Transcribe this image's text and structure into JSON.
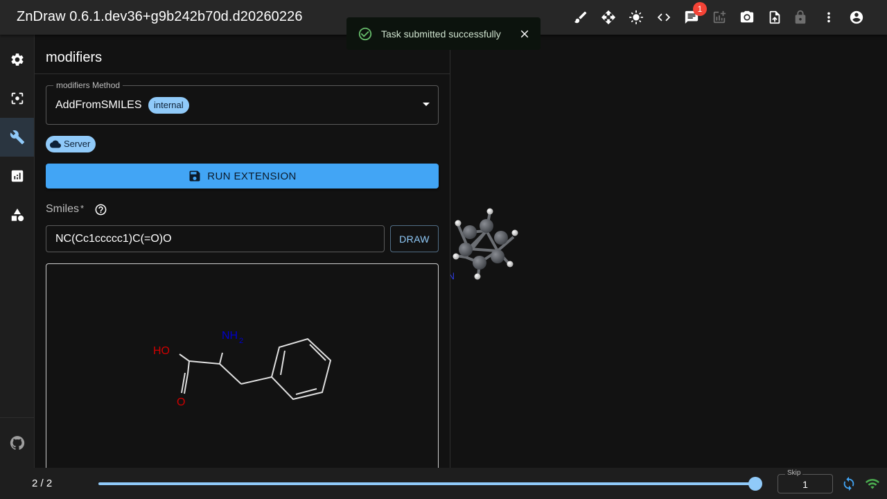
{
  "app": {
    "title": "ZnDraw 0.6.1.dev36+g9b242b70d.d20260226"
  },
  "toolbar": {
    "icons": [
      "brush-icon",
      "move-icon",
      "brightness-icon",
      "code-icon",
      "chat-icon",
      "add-chart-icon",
      "camera-icon",
      "upload-icon",
      "lock-icon",
      "more-vert-icon",
      "account-icon"
    ],
    "chat_badge": "1"
  },
  "toast": {
    "message": "Task submitted successfully",
    "color": "#66bb6a"
  },
  "sidebar": {
    "items": [
      "settings-icon",
      "selection-icon",
      "wrench-icon",
      "analysis-icon",
      "geometry-icon"
    ],
    "active": "wrench-icon",
    "footer": "github-icon"
  },
  "panel": {
    "title": "modifiers",
    "method_label": "modifiers Method",
    "method_value": "AddFromSMILES",
    "method_chip": "internal",
    "server_chip": "Server",
    "run_label": "RUN EXTENSION",
    "smiles_label": "Smiles",
    "smiles_required": "*",
    "smiles_value": "NC(Cc1ccccc1)C(=O)O",
    "draw_label": "DRAW"
  },
  "molecule": {
    "labels": {
      "hydroxyl": "HO",
      "amine": "NH",
      "amine_sub": "2",
      "carbonyl": "O"
    },
    "colors": {
      "oxygen": "#d00000",
      "nitrogen": "#0000cc",
      "bond": "#e0e0e0"
    }
  },
  "bottom": {
    "frame": "2 / 2",
    "progress": 1.0,
    "skip_label": "Skip",
    "skip_value": "1"
  },
  "colors": {
    "accent": "#90caf9",
    "primary_button": "#42a5f5",
    "badge": "#f44336",
    "connected": "#4caf50"
  }
}
